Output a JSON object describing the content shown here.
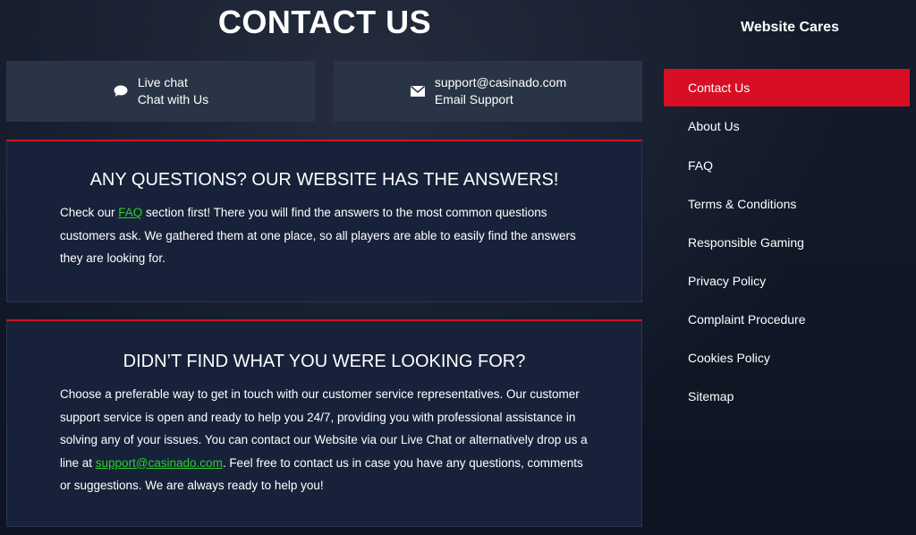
{
  "page_title": "CONTACT US",
  "contacts": [
    {
      "icon": "chat-bubble-icon",
      "line1": "Live chat",
      "line2": "Chat with Us"
    },
    {
      "icon": "envelope-icon",
      "line1": "support@casinado.com",
      "line2": "Email Support"
    }
  ],
  "faq_panel": {
    "heading": "ANY QUESTIONS? OUR WEBSITE HAS THE ANSWERS!",
    "text_before": "Check our ",
    "link": "FAQ",
    "text_after": " section first! There you will find the answers to the most common questions customers ask. We gathered them at one place, so all players are able to easily find the answers they are looking for."
  },
  "support_panel": {
    "heading": "DIDN’T FIND WHAT YOU WERE LOOKING FOR?",
    "text_before": "Choose a preferable way to get in touch with our customer service representatives. Our customer support service is open and ready to help you 24/7, providing you with professional assistance in solving any of your issues. You can contact our Website via our Live Chat or alternatively drop us a line at ",
    "link": "support@casinado.com",
    "text_after": ". Feel free to contact us in case you have any questions, comments or suggestions. We are always ready to help you!"
  },
  "sidebar": {
    "title": "Website Cares",
    "items": [
      {
        "label": "Contact Us",
        "active": true
      },
      {
        "label": "About Us"
      },
      {
        "label": "FAQ"
      },
      {
        "label": "Terms & Conditions"
      },
      {
        "label": "Responsible Gaming"
      },
      {
        "label": "Privacy Policy"
      },
      {
        "label": "Complaint Procedure"
      },
      {
        "label": "Cookies Policy"
      },
      {
        "label": "Sitemap"
      }
    ]
  },
  "colors": {
    "accent": "#d80f24",
    "link": "#2ecc2e",
    "panel_bg": "#17223a",
    "contact_bg": "#2a3447"
  }
}
